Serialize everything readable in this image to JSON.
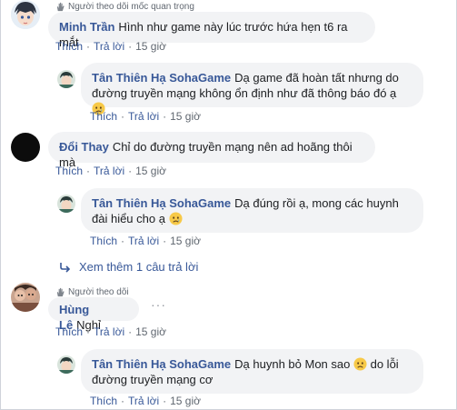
{
  "colors": {
    "link": "#385898",
    "muted": "#606770",
    "bubble": "#f2f3f5"
  },
  "labels": {
    "like": "Thích",
    "reply": "Trả lời",
    "dot": "·"
  },
  "icons": {
    "follower": "waving-hand-icon",
    "sad": "sad-face-emoji",
    "reply_arrow": "reply-arrow-icon",
    "options": "more-options-icon"
  },
  "comments": [
    {
      "badge": "Người theo dõi mốc quan trọng",
      "author": "Minh Trần",
      "text": "Hình như game này lúc trước hứa hẹn t6 ra mắt",
      "time": "15 giờ",
      "reply": {
        "author": "Tân Thiên Hạ SohaGame",
        "text": "Dạ game đã hoàn tất nhưng do đường truyền mạng không ổn định như đã thông báo đó ạ",
        "time": "15 giờ"
      }
    },
    {
      "author": "Đổi Thay",
      "text": "Chỉ do đường truyền mạng nên ad hoãng thôi mà",
      "time": "15 giờ",
      "reply": {
        "author": "Tân Thiên Hạ SohaGame",
        "text": "Dạ đúng rồi ạ, mong các huynh đài hiểu cho ạ",
        "time": "15 giờ"
      },
      "more_replies": "Xem thêm 1 câu trả lời"
    },
    {
      "badge": "Người theo dõi",
      "author": "Hùng Lê",
      "text": "Nghỉ",
      "time": "15 giờ",
      "options": "···",
      "reply": {
        "author": "Tân Thiên Hạ SohaGame",
        "text": "Dạ huynh bỏ Mon sao",
        "text_after": "do lỗi đường truyền mạng cơ",
        "time": "15 giờ"
      }
    }
  ]
}
